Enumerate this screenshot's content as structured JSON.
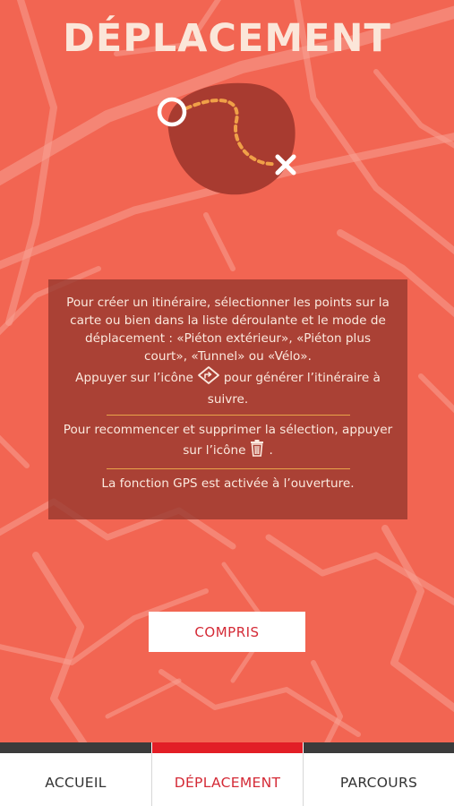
{
  "colors": {
    "background": "#f26552",
    "title_text": "#fbe6d9",
    "overlay_box": "#96372d",
    "accent_orange": "#e8a44a",
    "button_text": "#d42a36",
    "tab_active_indicator": "#e21e26",
    "tab_inactive_indicator": "#3b3b3b"
  },
  "header": {
    "title": "DÉPLACEMENT"
  },
  "hero_illustration": {
    "icons": [
      "start-circle-icon",
      "dotted-route-icon",
      "destination-x-icon"
    ]
  },
  "instructions": {
    "paragraph1_text": "Pour créer un itinéraire, sélectionner les points sur la carte ou bien dans la liste déroulante et le mode de déplacement : «Piéton extérieur», «Piéton plus court», «Tunnel» ou «Vélo».",
    "paragraph1_icon_before": "Appuyer sur l’icône",
    "paragraph1_icon_after": "pour générer l’itinéraire à suivre.",
    "paragraph1_icon": "route-diamond-icon",
    "paragraph2_text": "Pour recommencer et supprimer la sélection, appuyer sur l’icône",
    "paragraph2_icon": "trash-icon",
    "paragraph2_end": ".",
    "paragraph3_text": "La fonction GPS est activée à l’ouverture."
  },
  "confirm_button": {
    "label": "COMPRIS"
  },
  "tab_bar": {
    "tabs": [
      {
        "label": "ACCUEIL",
        "active": false
      },
      {
        "label": "DÉPLACEMENT",
        "active": true
      },
      {
        "label": "PARCOURS",
        "active": false
      }
    ]
  }
}
